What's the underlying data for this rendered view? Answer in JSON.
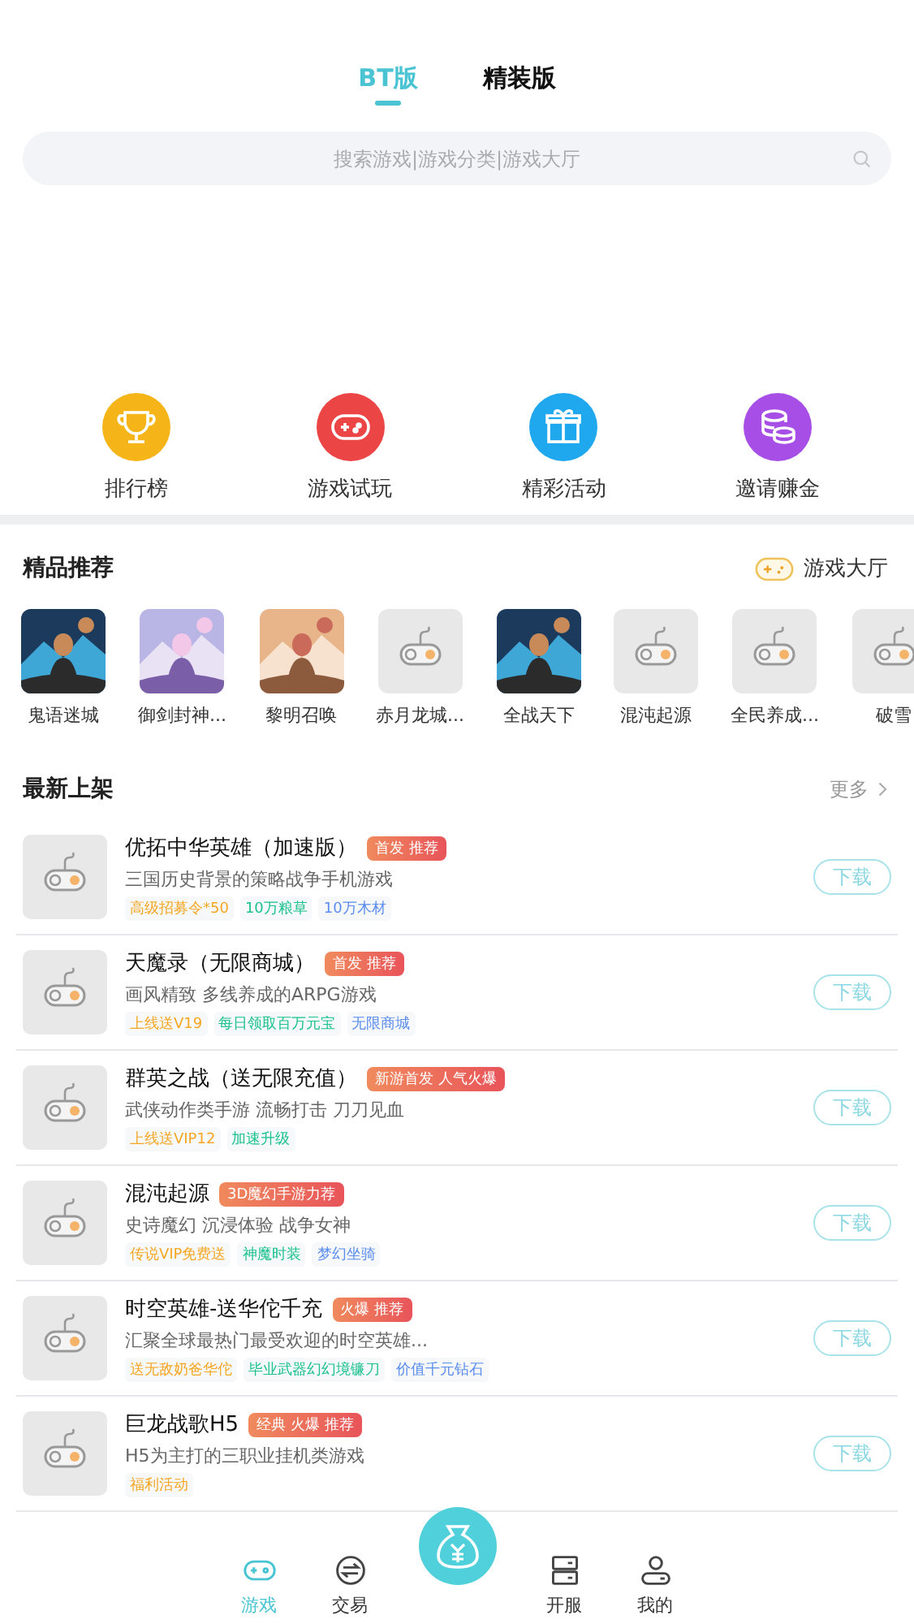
{
  "tabs": [
    {
      "label": "BT版",
      "selected": true
    },
    {
      "label": "精装版",
      "selected": false
    }
  ],
  "search": {
    "placeholder": "搜索游戏|游戏分类|游戏大厅"
  },
  "shortcuts": [
    {
      "label": "排行榜",
      "color": "#f5b417"
    },
    {
      "label": "游戏试玩",
      "color": "#ec4545"
    },
    {
      "label": "精彩活动",
      "color": "#1fa8ee"
    },
    {
      "label": "邀请赚金",
      "color": "#a64ee6"
    }
  ],
  "featured": {
    "title": "精品推荐",
    "link": "游戏大厅",
    "games": [
      {
        "name": "鬼语迷城",
        "kind": "picture"
      },
      {
        "name": "御剑封神...",
        "kind": "picture"
      },
      {
        "name": "黎明召唤",
        "kind": "picture"
      },
      {
        "name": "赤月龙城...",
        "kind": "placeholder"
      },
      {
        "name": "全战天下",
        "kind": "picture"
      },
      {
        "name": "混沌起源",
        "kind": "placeholder"
      },
      {
        "name": "全民养成...",
        "kind": "placeholder"
      },
      {
        "name": "破雪",
        "kind": "placeholder"
      }
    ]
  },
  "latest": {
    "title": "最新上架",
    "more": "更多",
    "games": [
      {
        "name": "优拓中华英雄（加速版）",
        "badge": "首发 推荐",
        "desc": "三国历史背景的策略战争手机游戏",
        "tags": [
          {
            "text": "高级招募令*50",
            "color": "#f5a623"
          },
          {
            "text": "10万粮草",
            "color": "#1cc28a"
          },
          {
            "text": "10万木材",
            "color": "#5b8def"
          }
        ],
        "button": "下载"
      },
      {
        "name": "天魔录（无限商城）",
        "badge": "首发 推荐",
        "desc": "画风精致 多线养成的ARPG游戏",
        "tags": [
          {
            "text": "上线送V19",
            "color": "#f5a623"
          },
          {
            "text": "每日领取百万元宝",
            "color": "#1cc28a"
          },
          {
            "text": "无限商城",
            "color": "#5b8def"
          }
        ],
        "button": "下载"
      },
      {
        "name": "群英之战（送无限充值）",
        "badge": "新游首发 人气火爆",
        "desc": "武侠动作类手游 流畅打击 刀刀见血",
        "tags": [
          {
            "text": "上线送VIP12",
            "color": "#f5a623"
          },
          {
            "text": "加速升级",
            "color": "#1cc28a"
          }
        ],
        "button": "下载"
      },
      {
        "name": "混沌起源",
        "badge": "3D魔幻手游力荐",
        "desc": "史诗魔幻 沉浸体验 战争女神",
        "tags": [
          {
            "text": "传说VIP免费送",
            "color": "#f5a623"
          },
          {
            "text": "神魔时装",
            "color": "#1cc28a"
          },
          {
            "text": "梦幻坐骑",
            "color": "#5b8def"
          }
        ],
        "button": "下载"
      },
      {
        "name": "时空英雄-送华佗千充",
        "badge": "火爆 推荐",
        "desc": "汇聚全球最热门最受欢迎的时空英雄...",
        "tags": [
          {
            "text": "送无敌奶爸华佗",
            "color": "#f5a623"
          },
          {
            "text": "毕业武器幻幻境镰刀",
            "color": "#1cc28a"
          },
          {
            "text": "价值千元钻石",
            "color": "#5b8def"
          }
        ],
        "button": "下载"
      },
      {
        "name": "巨龙战歌H5",
        "badge": "经典 火爆 推荐",
        "desc": "H5为主打的三职业挂机类游戏",
        "tags": [
          {
            "text": "福利活动",
            "color": "#f5a623"
          }
        ],
        "button": "下载"
      }
    ]
  },
  "bottom_nav": [
    {
      "kind": "tab",
      "label": "游戏",
      "selected": true
    },
    {
      "kind": "tab",
      "label": "交易",
      "selected": false
    },
    {
      "kind": "center",
      "selected": false
    },
    {
      "kind": "tab",
      "label": "开服",
      "selected": false
    },
    {
      "kind": "tab",
      "label": "我的",
      "selected": false
    }
  ]
}
